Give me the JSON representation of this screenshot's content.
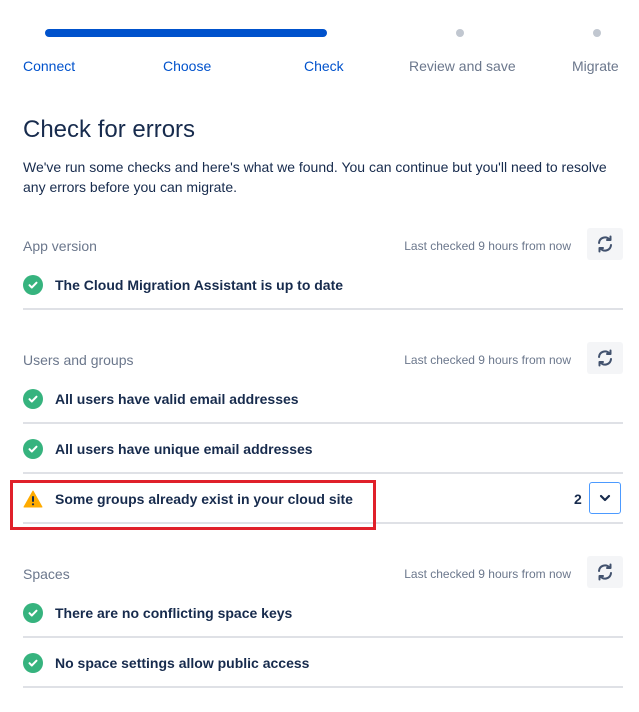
{
  "progress": {
    "fraction_complete": 0.5,
    "steps": [
      {
        "label": "Connect",
        "state": "done"
      },
      {
        "label": "Choose",
        "state": "done"
      },
      {
        "label": "Check",
        "state": "current"
      },
      {
        "label": "Review and save",
        "state": "todo"
      },
      {
        "label": "Migrate",
        "state": "todo"
      }
    ]
  },
  "header": {
    "title": "Check for errors",
    "description": "We've run some checks and here's what we found. You can continue but you'll need to resolve any errors before you can migrate."
  },
  "sections": [
    {
      "title": "App version",
      "last_checked": "Last checked 9 hours from now",
      "checks": [
        {
          "label": "The Cloud Migration Assistant is up to date",
          "status": "success"
        }
      ]
    },
    {
      "title": "Users and groups",
      "last_checked": "Last checked 9 hours from now",
      "checks": [
        {
          "label": "All users have valid email addresses",
          "status": "success"
        },
        {
          "label": "All users have unique email addresses",
          "status": "success"
        },
        {
          "label": "Some groups already exist in your cloud site",
          "status": "warning",
          "count": "2"
        }
      ]
    },
    {
      "title": "Spaces",
      "last_checked": "Last checked 9 hours from now",
      "checks": [
        {
          "label": "There are no conflicting space keys",
          "status": "success"
        },
        {
          "label": "No space settings allow public access",
          "status": "success"
        }
      ]
    }
  ],
  "icons": {
    "success": "check-circle-icon",
    "warning": "warning-triangle-icon",
    "refresh": "refresh-icon",
    "expand": "chevron-down-icon"
  },
  "colors": {
    "accent": "#0052cc",
    "success": "#36b37e",
    "warning": "#ffab00",
    "muted": "#6b778c",
    "highlight": "#e0202a"
  }
}
